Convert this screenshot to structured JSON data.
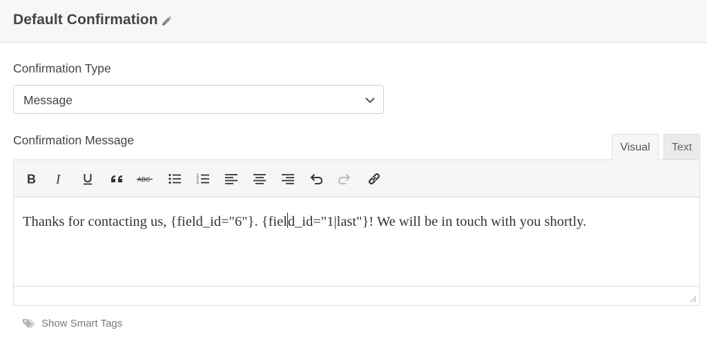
{
  "header": {
    "title": "Default Confirmation",
    "edit_icon": "pencil-icon"
  },
  "confirmation_type": {
    "label": "Confirmation Type",
    "selected": "Message",
    "icon": "chevron-down-icon"
  },
  "confirmation_message": {
    "label": "Confirmation Message",
    "tabs": [
      {
        "label": "Visual",
        "active": true
      },
      {
        "label": "Text",
        "active": false
      }
    ],
    "toolbar": [
      "bold-icon",
      "italic-icon",
      "underline-icon",
      "blockquote-icon",
      "strikethrough-icon",
      "bulleted-list-icon",
      "numbered-list-icon",
      "align-left-icon",
      "align-center-icon",
      "align-right-icon",
      "undo-icon",
      "redo-icon",
      "link-icon"
    ],
    "content_before_caret": "Thanks for contacting us, {field_id=\"6\"}. {fiel",
    "content_after_caret": "d_id=\"1|last\"}! We will be in touch with you shortly."
  },
  "smart_tags": {
    "label": "Show Smart Tags",
    "icon": "tags-icon"
  },
  "colors": {
    "text": "#444444",
    "header_bg": "#f7f7f7",
    "toolbar_bg": "#f6f6f6",
    "border": "#dcdcdc"
  }
}
